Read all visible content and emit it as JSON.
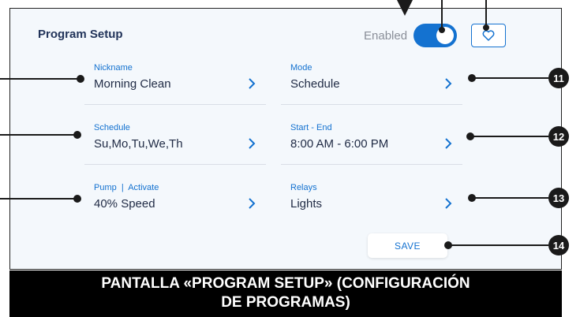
{
  "screen": {
    "title": "Program Setup",
    "enabled_label": "Enabled",
    "enabled_state": true
  },
  "fields": [
    {
      "label": "Nickname",
      "value": "Morning Clean"
    },
    {
      "label": "Mode",
      "value": "Schedule"
    },
    {
      "label": "Schedule",
      "value": "Su,Mo,Tu,We,Th"
    },
    {
      "label": "Start - End",
      "value": "8:00 AM - 6:00 PM"
    },
    {
      "label": "Pump  |  Activate",
      "value": "40% Speed"
    },
    {
      "label": "Relays",
      "value": "Lights"
    }
  ],
  "save_label": "SAVE",
  "callouts": [
    "11",
    "12",
    "13",
    "14"
  ],
  "caption": {
    "line1": "PANTALLA «PROGRAM SETUP» (CONFIGURACIÓN",
    "line2": "DE PROGRAMAS)"
  },
  "colors": {
    "accent": "#1472d0",
    "panel_bg": "#f4f8fc",
    "callout": "#1a1a1a"
  }
}
